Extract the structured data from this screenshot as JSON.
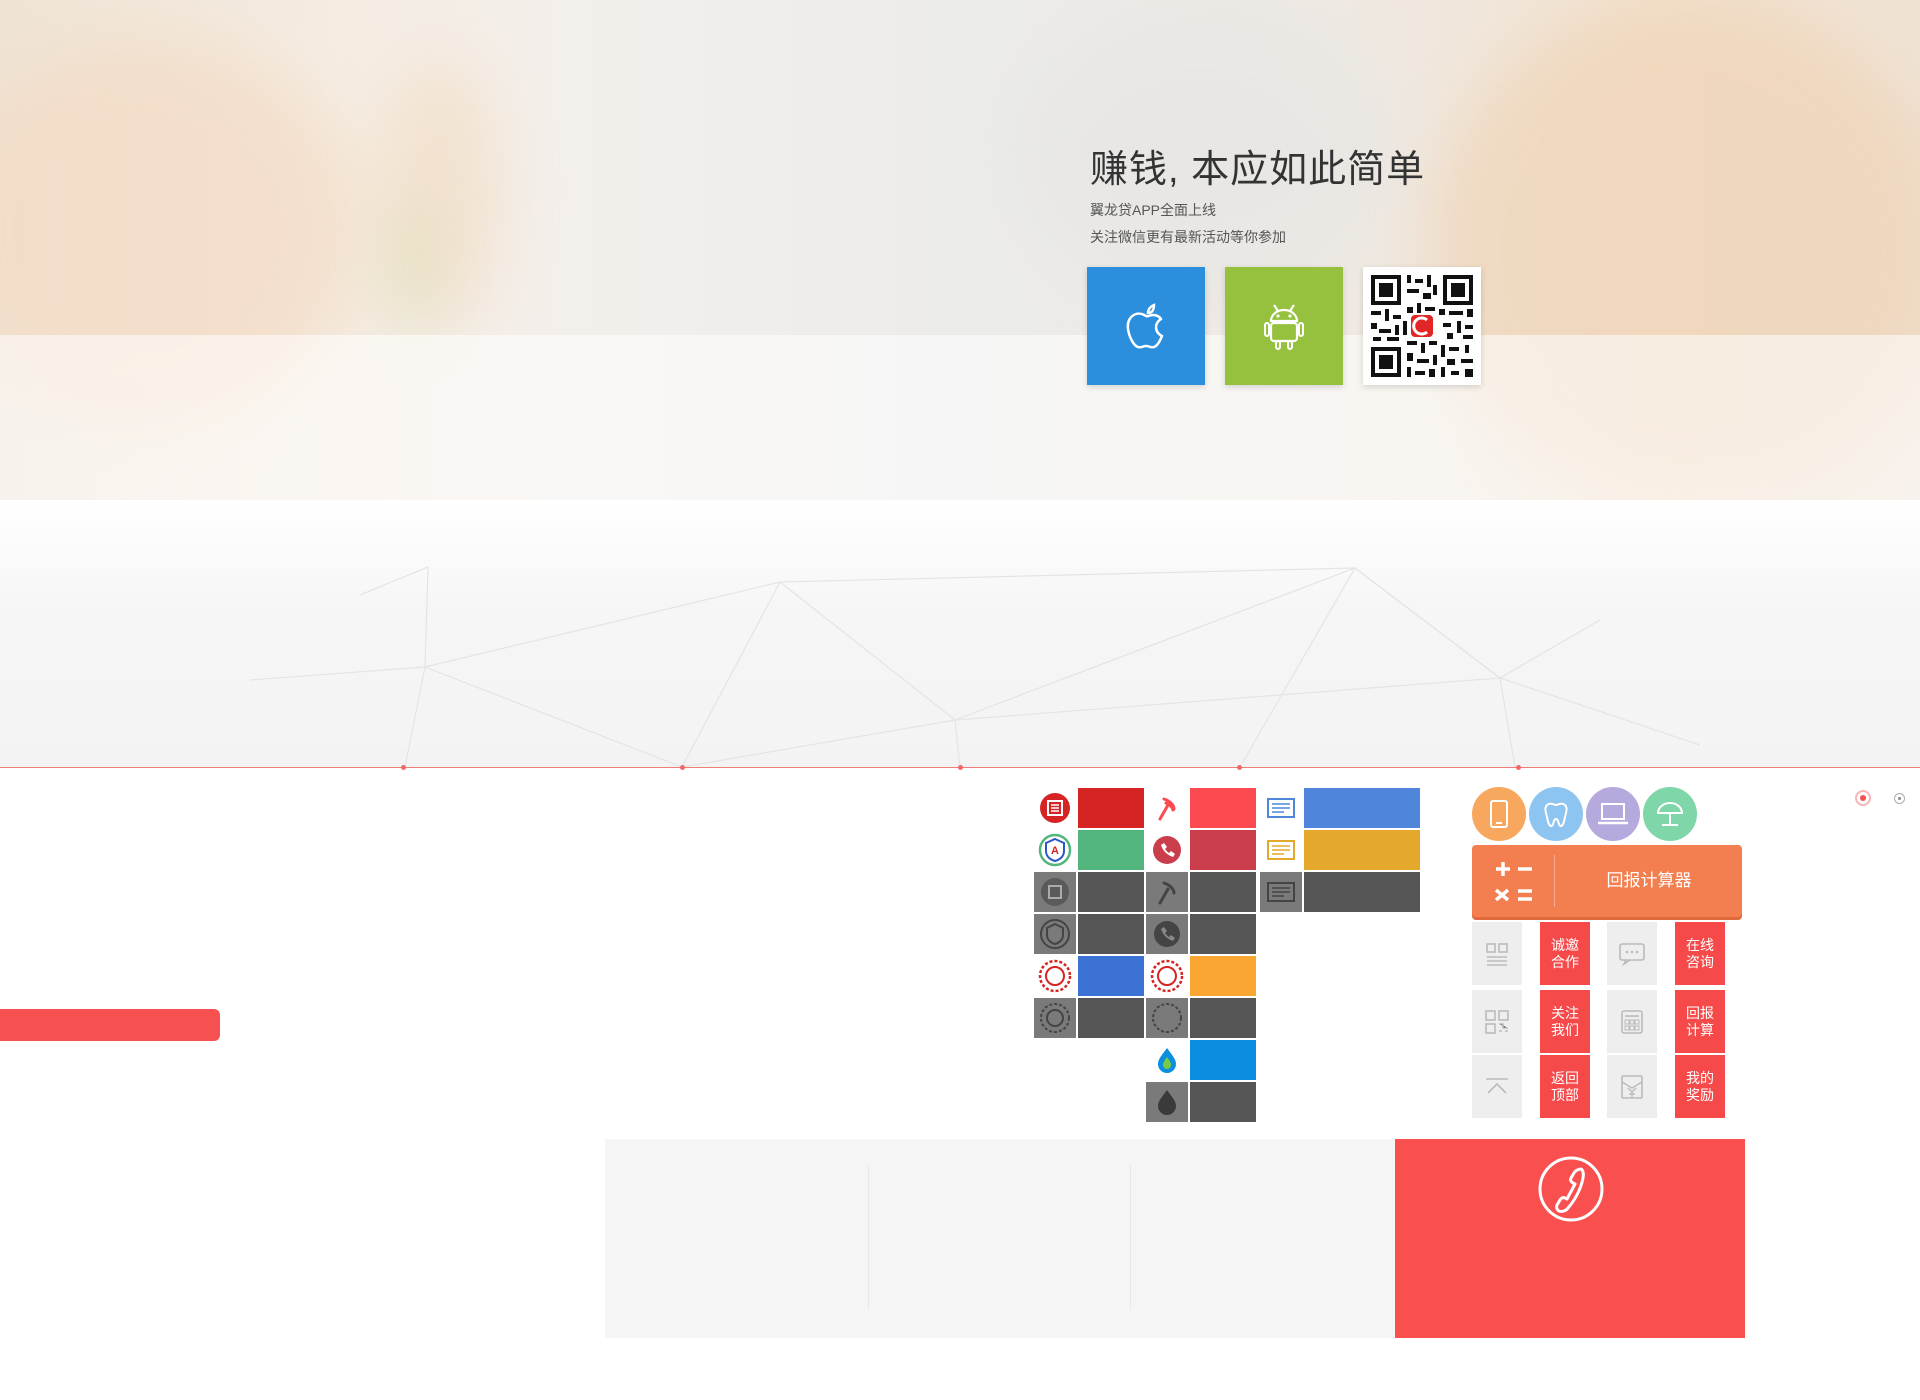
{
  "hero": {
    "title": "赚钱, 本应如此简单",
    "subtitle1": "翼龙贷APP全面上线",
    "subtitle2": "关注微信更有最新活动等你参加",
    "ios_icon": "apple-icon",
    "android_icon": "android-icon",
    "qr_icon": "qr-code",
    "colors": {
      "ios": "#2b8fde",
      "android": "#95c13e"
    }
  },
  "tools": {
    "calculator_label": "回报计算器",
    "category_icons": [
      "phone-icon",
      "tooth-icon",
      "laptop-icon",
      "beach-umbrella-icon"
    ],
    "category_colors": [
      "#f7a85e",
      "#8ec4f0",
      "#b6a9dd",
      "#7fd6a8"
    ],
    "tiles": [
      {
        "icon": "alliance-icon",
        "label": "诚邀合作"
      },
      {
        "icon": "chat-icon",
        "label": "在线咨询"
      },
      {
        "icon": "qr-icon",
        "label": "关注我们"
      },
      {
        "icon": "calculator-icon",
        "label": "回报计算"
      },
      {
        "icon": "arrow-up-icon",
        "label": "返回顶部"
      },
      {
        "icon": "reward-icon",
        "label": "我的奖励"
      }
    ]
  },
  "badges": {
    "colors": [
      "#d62424",
      "#52b57e",
      "#4a4a4a",
      "#3c72d4",
      "#fc4a50",
      "#c93e4a",
      "#f9a632",
      "#0b8ee0",
      "#4f86dc",
      "#e3a82c"
    ]
  },
  "footer": {
    "phone_icon": "phone-icon"
  }
}
